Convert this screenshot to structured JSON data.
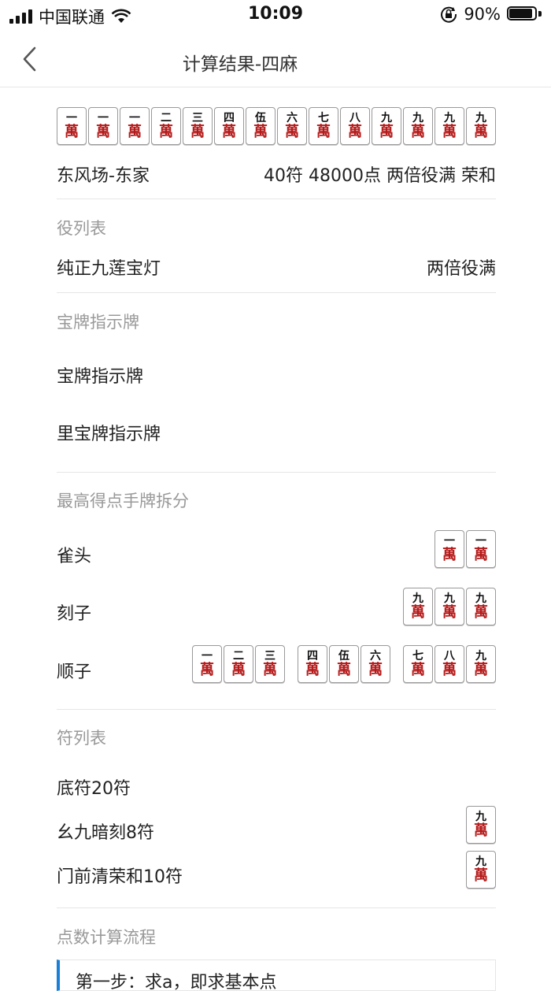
{
  "status": {
    "carrier": "中国联通",
    "time": "10:09",
    "battery": "90%"
  },
  "nav": {
    "title": "计算结果-四麻"
  },
  "hand": [
    {
      "n": "一",
      "s": "萬"
    },
    {
      "n": "一",
      "s": "萬"
    },
    {
      "n": "一",
      "s": "萬"
    },
    {
      "n": "二",
      "s": "萬"
    },
    {
      "n": "三",
      "s": "萬"
    },
    {
      "n": "四",
      "s": "萬"
    },
    {
      "n": "伍",
      "s": "萬"
    },
    {
      "n": "六",
      "s": "萬"
    },
    {
      "n": "七",
      "s": "萬"
    },
    {
      "n": "八",
      "s": "萬"
    },
    {
      "n": "九",
      "s": "萬"
    },
    {
      "n": "九",
      "s": "萬"
    },
    {
      "n": "九",
      "s": "萬"
    },
    {
      "n": "九",
      "s": "萬"
    }
  ],
  "summary": {
    "wind": "东风场-东家",
    "result": "40符 48000点 两倍役满 荣和"
  },
  "yaku": {
    "title": "役列表",
    "items": [
      {
        "name": "纯正九莲宝灯",
        "value": "两倍役满"
      }
    ]
  },
  "dora": {
    "title": "宝牌指示牌",
    "dora_label": "宝牌指示牌",
    "ura_label": "里宝牌指示牌"
  },
  "split": {
    "title": "最高得点手牌拆分",
    "pair_label": "雀头",
    "pair": [
      {
        "n": "一",
        "s": "萬"
      },
      {
        "n": "一",
        "s": "萬"
      }
    ],
    "triplet_label": "刻子",
    "triplet": [
      {
        "n": "九",
        "s": "萬"
      },
      {
        "n": "九",
        "s": "萬"
      },
      {
        "n": "九",
        "s": "萬"
      }
    ],
    "seq_label": "顺子",
    "sequences": [
      [
        {
          "n": "一",
          "s": "萬"
        },
        {
          "n": "二",
          "s": "萬"
        },
        {
          "n": "三",
          "s": "萬"
        }
      ],
      [
        {
          "n": "四",
          "s": "萬"
        },
        {
          "n": "伍",
          "s": "萬"
        },
        {
          "n": "六",
          "s": "萬"
        }
      ],
      [
        {
          "n": "七",
          "s": "萬"
        },
        {
          "n": "八",
          "s": "萬"
        },
        {
          "n": "九",
          "s": "萬"
        }
      ]
    ]
  },
  "fu": {
    "title": "符列表",
    "items": [
      {
        "label": "底符20符"
      },
      {
        "label": "幺九暗刻8符",
        "tile": {
          "n": "九",
          "s": "萬"
        }
      },
      {
        "label": "门前清荣和10符",
        "tile": {
          "n": "九",
          "s": "萬"
        }
      }
    ]
  },
  "flow": {
    "title": "点数计算流程",
    "step1": "第一步：求a，即求基本点"
  }
}
